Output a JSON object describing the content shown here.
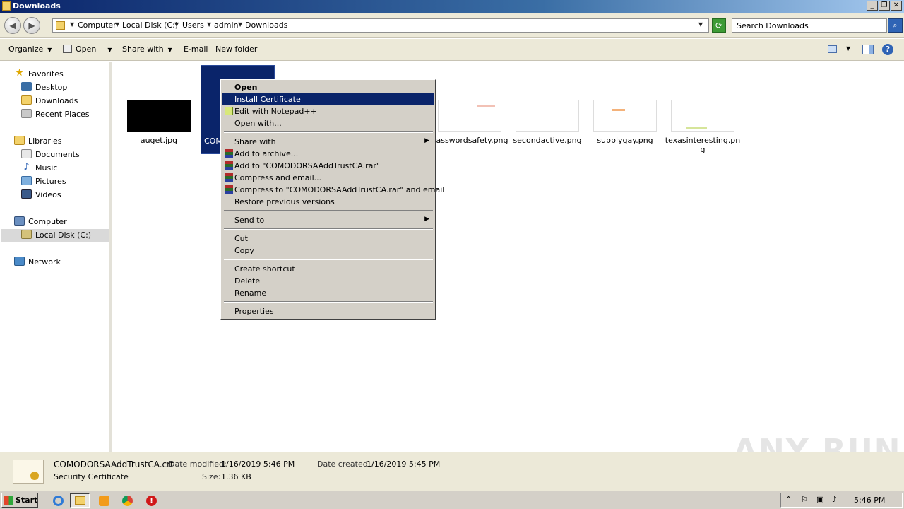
{
  "window": {
    "title": "Downloads",
    "controls": [
      "_",
      "❐",
      "✕"
    ]
  },
  "address": {
    "crumbs": [
      "Computer",
      "Local Disk (C:)",
      "Users",
      "admin",
      "Downloads"
    ],
    "search_placeholder": "Search Downloads"
  },
  "toolbar": {
    "organize": "Organize",
    "open": "Open",
    "share_with": "Share with",
    "email": "E-mail",
    "new_folder": "New folder"
  },
  "sidebar": {
    "favorites": "Favorites",
    "desktop": "Desktop",
    "downloads": "Downloads",
    "recent_places": "Recent Places",
    "libraries": "Libraries",
    "documents": "Documents",
    "music": "Music",
    "pictures": "Pictures",
    "videos": "Videos",
    "computer": "Computer",
    "local_disk": "Local Disk (C:)",
    "network": "Network"
  },
  "files": [
    {
      "name": "auget.jpg"
    },
    {
      "name": "COM"
    },
    {
      "name": "passwordsafety.png"
    },
    {
      "name": "secondactive.png"
    },
    {
      "name": "supplygay.png"
    },
    {
      "name": "texasinteresting.png"
    }
  ],
  "context_menu": {
    "open": "Open",
    "install_certificate": "Install Certificate",
    "edit_notepad": "Edit with Notepad++",
    "open_with": "Open with...",
    "share_with": "Share with",
    "add_to_archive": "Add to archive...",
    "add_to_rar": "Add to \"COMODORSAAddTrustCA.rar\"",
    "compress_email": "Compress and email...",
    "compress_rar_email": "Compress to \"COMODORSAAddTrustCA.rar\" and email",
    "restore_versions": "Restore previous versions",
    "send_to": "Send to",
    "cut": "Cut",
    "copy": "Copy",
    "create_shortcut": "Create shortcut",
    "delete": "Delete",
    "rename": "Rename",
    "properties": "Properties"
  },
  "details": {
    "filename": "COMODORSAAddTrustCA.crt",
    "type": "Security Certificate",
    "date_modified_label": "Date modified:",
    "date_modified": "1/16/2019 5:46 PM",
    "size_label": "Size:",
    "size": "1.36 KB",
    "date_created_label": "Date created:",
    "date_created": "1/16/2019 5:45 PM"
  },
  "taskbar": {
    "start": "Start",
    "clock": "5:46 PM"
  },
  "watermark": "ANY RUN",
  "colors": {
    "selection": "#0a246a",
    "chrome": "#ece9d8",
    "menu": "#d4d0c8"
  }
}
